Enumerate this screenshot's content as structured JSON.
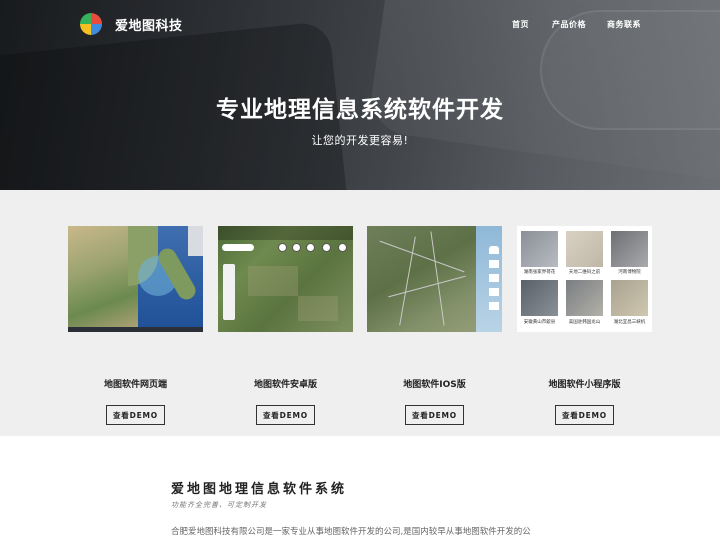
{
  "header": {
    "brand": "爱地图科技",
    "logo_icon": "pie-logo-icon",
    "nav": [
      {
        "label": "首页"
      },
      {
        "label": "产品价格"
      },
      {
        "label": "商务联系"
      }
    ]
  },
  "hero": {
    "title": "专业地理信息系统软件开发",
    "subtitle": "让您的开发更容易!"
  },
  "demos": {
    "items": [
      {
        "title": "地图软件网页端",
        "button": "查看DEMO"
      },
      {
        "title": "地图软件安卓版",
        "button": "查看DEMO"
      },
      {
        "title": "地图软件IOS版",
        "button": "查看DEMO"
      },
      {
        "title": "地图软件小程序版",
        "button": "查看DEMO"
      }
    ],
    "miniapp_captions": [
      "湖南张家界荷花",
      "天地二维码之前",
      "河南博物院",
      "安徽黄山市歙县",
      "美国驻韩国龙山",
      "湖北宜昌三峡机"
    ]
  },
  "info": {
    "title": "爱地图地理信息软件系统",
    "subtitle": "功能齐全完善、可定制开发",
    "text": "合肥爱地图科技有限公司是一家专业从事地图软件开发的公司,是国内较早从事地图软件开发的公"
  },
  "colors": {
    "demo_section_bg": "#efefef",
    "hero_text": "#ffffff"
  }
}
